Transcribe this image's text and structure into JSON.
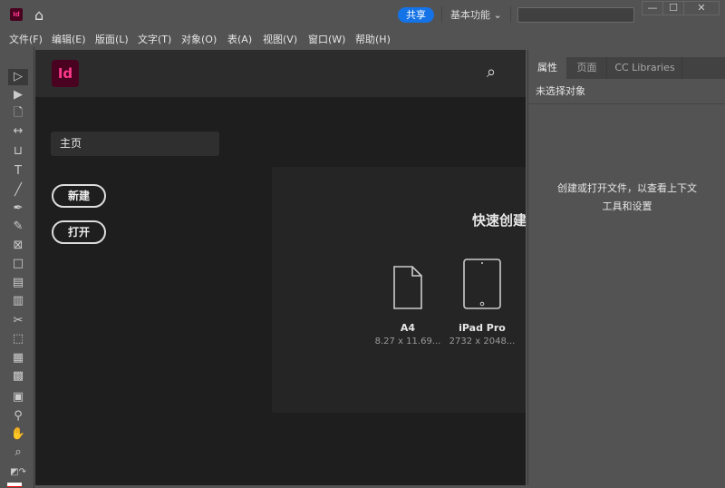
{
  "titlebar": {
    "app_icon": "Id",
    "share": "共享",
    "workspace": "基本功能",
    "window_buttons": {
      "minimize": "—",
      "maximize": "☐",
      "close": "✕"
    }
  },
  "menu": [
    "文件(F)",
    "编辑(E)",
    "版面(L)",
    "文字(T)",
    "对象(O)",
    "表(A)",
    "视图(V)",
    "窗口(W)",
    "帮助(H)"
  ],
  "tools": [
    "selection-tool",
    "direct-selection-tool",
    "page-tool",
    "gap-tool",
    "content-collector-tool",
    "type-tool",
    "line-tool",
    "pen-tool",
    "pencil-tool",
    "rectangle-frame-tool",
    "rectangle-tool",
    "horizontal-grid-tool",
    "vertical-grid-tool",
    "scissors-tool",
    "free-transform-tool",
    "gradient-swatch-tool",
    "gradient-feather-tool",
    "note-tool",
    "eyedropper-tool",
    "hand-tool",
    "zoom-tool"
  ],
  "home": {
    "logo": "Id",
    "nav_home": "主页",
    "new_button": "新建",
    "open_button": "打开",
    "quick_create": "快速创建",
    "presets": [
      {
        "name": "A4",
        "size": "8.27 x 11.69..."
      },
      {
        "name": "iPad Pro",
        "size": "2732 x 2048..."
      }
    ]
  },
  "panel": {
    "tabs": [
      "属性",
      "页面",
      "CC Libraries"
    ],
    "no_selection": "未选择对象",
    "message_line1": "创建或打开文件，以查看上下文",
    "message_line2": "工具和设置"
  }
}
